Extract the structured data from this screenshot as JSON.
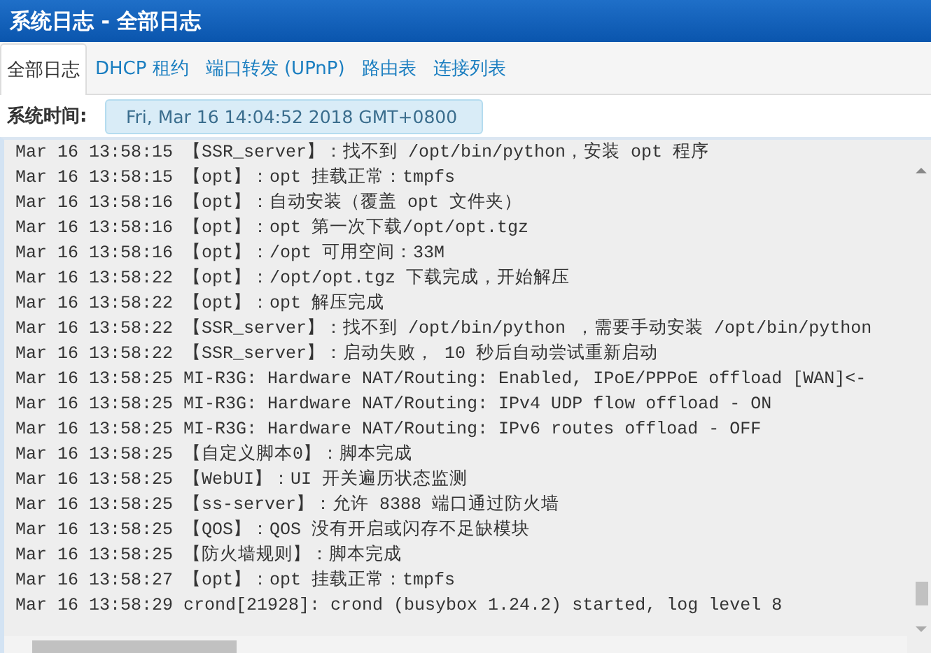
{
  "window": {
    "title": "系统日志 - 全部日志"
  },
  "tabs": [
    {
      "label": "全部日志",
      "selected": true
    },
    {
      "label": "DHCP 租约",
      "selected": false
    },
    {
      "label": "端口转发 (UPnP)",
      "selected": false
    },
    {
      "label": "路由表",
      "selected": false
    },
    {
      "label": "连接列表",
      "selected": false
    }
  ],
  "system_time": {
    "label": "系统时间:",
    "value": "Fri, Mar 16 14:04:52 2018 GMT+0800"
  },
  "log": [
    "Mar 16 13:58:15 【SSR_server】：找不到 /opt/bin/python，安装 opt 程序",
    "Mar 16 13:58:15 【opt】：opt 挂载正常：tmpfs",
    "Mar 16 13:58:16 【opt】：自动安装（覆盖 opt 文件夹）",
    "Mar 16 13:58:16 【opt】：opt 第一次下载/opt/opt.tgz",
    "Mar 16 13:58:16 【opt】：/opt 可用空间：33M",
    "Mar 16 13:58:22 【opt】：/opt/opt.tgz 下载完成，开始解压",
    "Mar 16 13:58:22 【opt】：opt 解压完成",
    "Mar 16 13:58:22 【SSR_server】：找不到 /opt/bin/python ，需要手动安装 /opt/bin/python",
    "Mar 16 13:58:22 【SSR_server】：启动失败， 10 秒后自动尝试重新启动",
    "Mar 16 13:58:25 MI-R3G: Hardware NAT/Routing: Enabled, IPoE/PPPoE offload [WAN]<-",
    "Mar 16 13:58:25 MI-R3G: Hardware NAT/Routing: IPv4 UDP flow offload - ON",
    "Mar 16 13:58:25 MI-R3G: Hardware NAT/Routing: IPv6 routes offload - OFF",
    "Mar 16 13:58:25 【自定义脚本0】：脚本完成",
    "Mar 16 13:58:25 【WebUI】：UI 开关遍历状态监测",
    "Mar 16 13:58:25 【ss-server】：允许 8388 端口通过防火墙",
    "Mar 16 13:58:25 【QOS】：QOS 没有开启或闪存不足缺模块",
    "Mar 16 13:58:25 【防火墙规则】：脚本完成",
    "Mar 16 13:58:27 【opt】：opt 挂载正常：tmpfs",
    "Mar 16 13:58:29 crond[21928]: crond (busybox 1.24.2) started, log level 8"
  ]
}
